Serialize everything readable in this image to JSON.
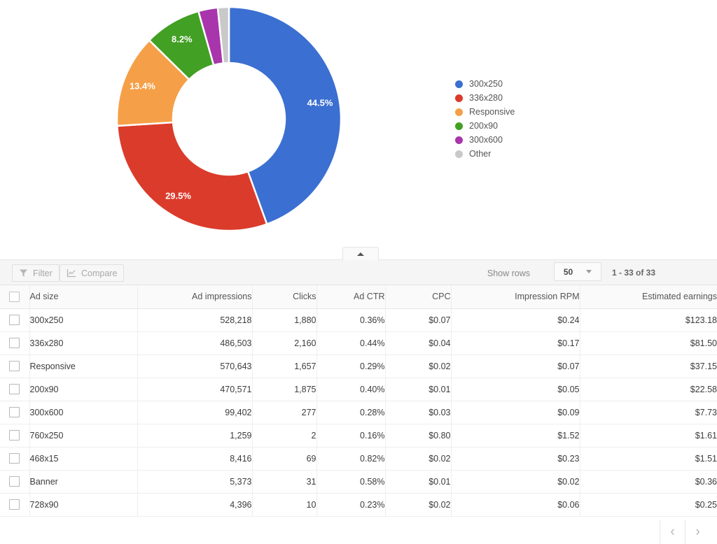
{
  "chart_data": {
    "type": "pie",
    "title": "",
    "donut": true,
    "legend_position": "right",
    "categories": [
      "300x250",
      "336x280",
      "Responsive",
      "200x90",
      "300x600",
      "Other"
    ],
    "values": [
      44.5,
      29.5,
      13.4,
      8.2,
      2.8,
      1.6
    ],
    "value_labels": [
      "44.5%",
      "29.5%",
      "13.4%",
      "8.2%",
      "",
      ""
    ],
    "colors": [
      "#3b6fd1",
      "#db3b2b",
      "#f5a048",
      "#42a024",
      "#a935ac",
      "#c9c9c9"
    ],
    "legend": [
      {
        "label": "300x250",
        "color": "#3b6fd1"
      },
      {
        "label": "336x280",
        "color": "#db3b2b"
      },
      {
        "label": "Responsive",
        "color": "#f5a048"
      },
      {
        "label": "200x90",
        "color": "#42a024"
      },
      {
        "label": "300x600",
        "color": "#a935ac"
      },
      {
        "label": "Other",
        "color": "#c9c9c9"
      }
    ]
  },
  "collapse_tab": {
    "icon": "triangle-up-icon"
  },
  "toolbar": {
    "filter_label": "Filter",
    "compare_label": "Compare",
    "show_rows_label": "Show rows",
    "rows_value": "50",
    "range_text": "1 - 33 of 33",
    "prev_icon": "‹",
    "next_icon": "›"
  },
  "table": {
    "columns": [
      "Ad size",
      "Ad impressions",
      "Clicks",
      "Ad CTR",
      "CPC",
      "Impression RPM",
      "Estimated earnings"
    ],
    "rows": [
      {
        "name": "300x250",
        "impressions": "528,218",
        "clicks": "1,880",
        "ctr": "0.36%",
        "cpc": "$0.07",
        "rpm": "$0.24",
        "earnings": "$123.18"
      },
      {
        "name": "336x280",
        "impressions": "486,503",
        "clicks": "2,160",
        "ctr": "0.44%",
        "cpc": "$0.04",
        "rpm": "$0.17",
        "earnings": "$81.50"
      },
      {
        "name": "Responsive",
        "impressions": "570,643",
        "clicks": "1,657",
        "ctr": "0.29%",
        "cpc": "$0.02",
        "rpm": "$0.07",
        "earnings": "$37.15"
      },
      {
        "name": "200x90",
        "impressions": "470,571",
        "clicks": "1,875",
        "ctr": "0.40%",
        "cpc": "$0.01",
        "rpm": "$0.05",
        "earnings": "$22.58"
      },
      {
        "name": "300x600",
        "impressions": "99,402",
        "clicks": "277",
        "ctr": "0.28%",
        "cpc": "$0.03",
        "rpm": "$0.09",
        "earnings": "$7.73"
      },
      {
        "name": "760x250",
        "impressions": "1,259",
        "clicks": "2",
        "ctr": "0.16%",
        "cpc": "$0.80",
        "rpm": "$1.52",
        "earnings": "$1.61"
      },
      {
        "name": "468x15",
        "impressions": "8,416",
        "clicks": "69",
        "ctr": "0.82%",
        "cpc": "$0.02",
        "rpm": "$0.23",
        "earnings": "$1.51"
      },
      {
        "name": "Banner",
        "impressions": "5,373",
        "clicks": "31",
        "ctr": "0.58%",
        "cpc": "$0.01",
        "rpm": "$0.02",
        "earnings": "$0.36"
      },
      {
        "name": "728x90",
        "impressions": "4,396",
        "clicks": "10",
        "ctr": "0.23%",
        "cpc": "$0.02",
        "rpm": "$0.06",
        "earnings": "$0.25"
      }
    ]
  }
}
